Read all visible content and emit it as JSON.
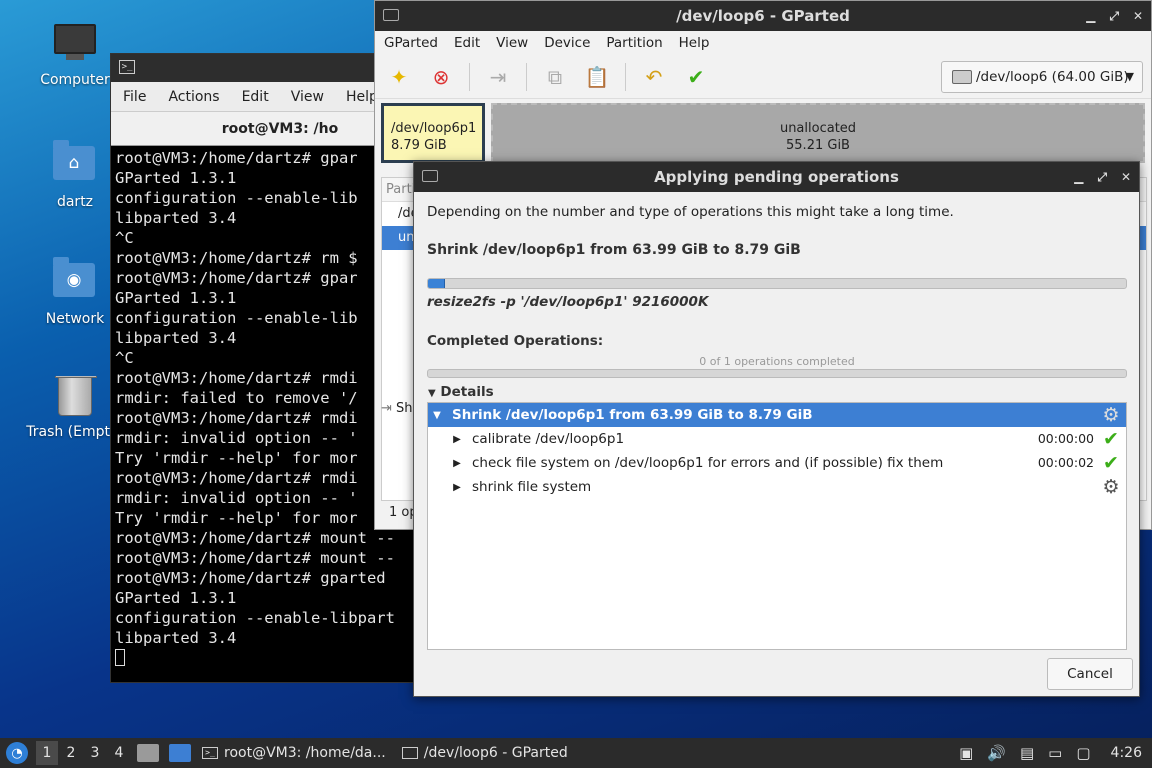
{
  "desktop": {
    "icons": [
      {
        "label": "Computer"
      },
      {
        "label": "dartz"
      },
      {
        "label": "Network"
      },
      {
        "label": "Trash (Empty)"
      }
    ]
  },
  "terminal": {
    "menu": [
      "File",
      "Actions",
      "Edit",
      "View",
      "Help"
    ],
    "title": "root@VM3: /ho",
    "lines": [
      "root@VM3:/home/dartz# gpar",
      "GParted 1.3.1",
      "configuration --enable-lib",
      "libparted 3.4",
      "^C",
      "root@VM3:/home/dartz# rm $",
      "root@VM3:/home/dartz# gpar",
      "GParted 1.3.1",
      "configuration --enable-lib",
      "libparted 3.4",
      "^C",
      "root@VM3:/home/dartz# rmdi",
      "rmdir: failed to remove '/",
      "root@VM3:/home/dartz# rmdi",
      "rmdir: invalid option -- '",
      "Try 'rmdir --help' for mor",
      "root@VM3:/home/dartz# rmdi",
      "rmdir: invalid option -- '",
      "Try 'rmdir --help' for mor",
      "root@VM3:/home/dartz# mount --",
      "root@VM3:/home/dartz# mount --",
      "root@VM3:/home/dartz# gparted",
      "GParted 1.3.1",
      "configuration --enable-libpart",
      "libparted 3.4"
    ]
  },
  "gparted": {
    "title": "/dev/loop6 - GParted",
    "menu": [
      "GParted",
      "Edit",
      "View",
      "Device",
      "Partition",
      "Help"
    ],
    "device": "/dev/loop6 (64.00 GiB)",
    "partitions": [
      {
        "name": "/dev/loop6p1",
        "size": "8.79 GiB"
      },
      {
        "name": "unallocated",
        "size": "55.21 GiB"
      }
    ],
    "list_header": "Parti",
    "list_rows": [
      "/de",
      "un"
    ],
    "ops_label": "Sh",
    "status": "1 op"
  },
  "dialog": {
    "title": "Applying pending operations",
    "description": "Depending on the number and type of operations this might take a long time.",
    "current_op": "Shrink /dev/loop6p1 from 63.99 GiB to 8.79 GiB",
    "current_progress": 0.025,
    "command": "resize2fs -p '/dev/loop6p1' 9216000K",
    "completed_label": "Completed Operations:",
    "completed_count": "0 of 1 operations completed",
    "completed_progress": 0,
    "details_label": "Details",
    "tree": {
      "root": "Shrink /dev/loop6p1 from 63.99 GiB to 8.79 GiB",
      "children": [
        {
          "label": "calibrate /dev/loop6p1",
          "time": "00:00:00",
          "status": "done"
        },
        {
          "label": "check file system on /dev/loop6p1 for errors and (if possible) fix them",
          "time": "00:00:02",
          "status": "done"
        },
        {
          "label": "shrink file system",
          "time": "",
          "status": "running"
        }
      ]
    },
    "cancel_label": "Cancel"
  },
  "taskbar": {
    "workspaces": [
      "1",
      "2",
      "3",
      "4"
    ],
    "tasks": [
      "root@VM3: /home/da...",
      "/dev/loop6 - GParted"
    ],
    "clock": "4:26"
  },
  "colors": {
    "accent": "#3d7fd3",
    "partition_fill": "#fbf6b4",
    "unallocated_fill": "#a8a8a8",
    "ok": "#3cae19"
  }
}
